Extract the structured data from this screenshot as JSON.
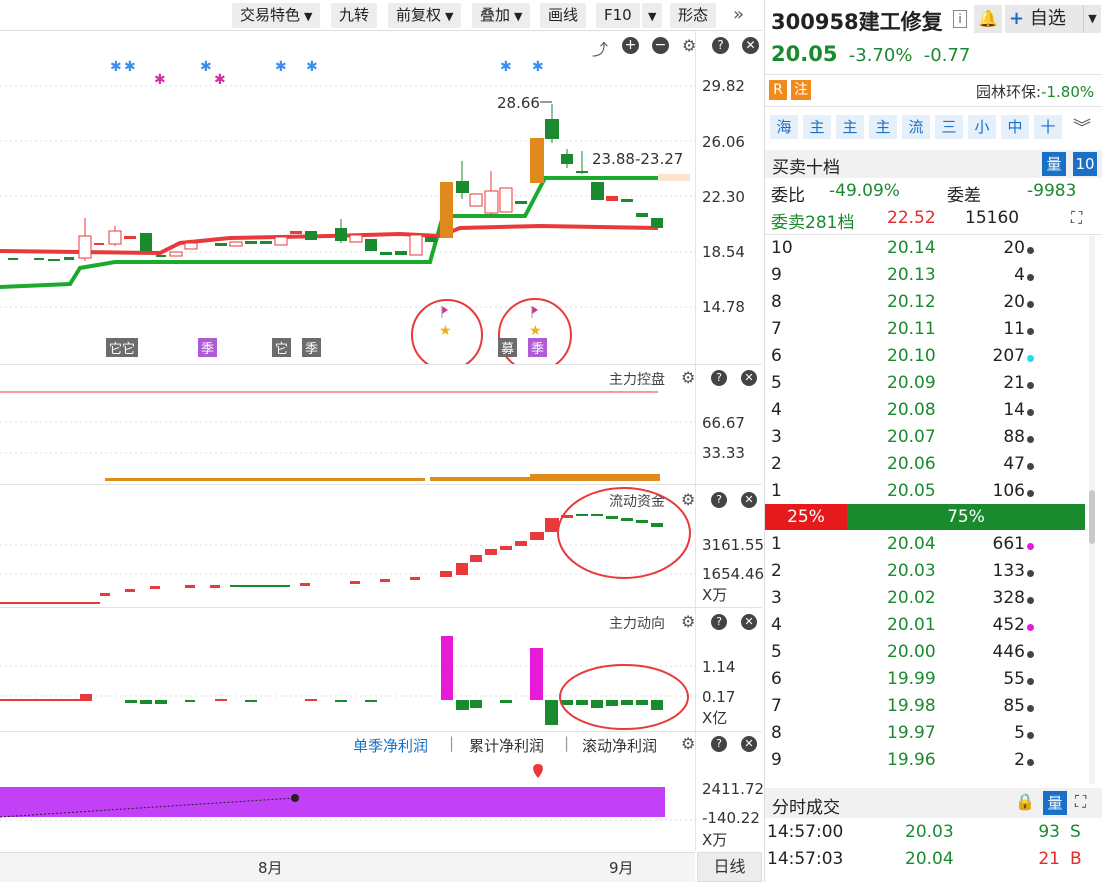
{
  "toolbar": {
    "items": [
      "交易特色",
      "九转",
      "前复权",
      "叠加",
      "画线",
      "F10",
      "形态"
    ],
    "more_icon": "double-chevron-right-icon"
  },
  "chart": {
    "y_labels": [
      "29.82",
      "26.06",
      "22.30",
      "18.54",
      "14.78"
    ],
    "annotation_high": "28.66",
    "annotation_range": "23.88-23.27",
    "bottom_tags": [
      "它它",
      "季",
      "它",
      "季",
      "募",
      "季"
    ]
  },
  "panels": {
    "control": {
      "title": "主力控盘",
      "y_labels": [
        "66.67",
        "33.33"
      ]
    },
    "flow": {
      "title": "流动资金",
      "y_labels": [
        "3161.55",
        "1654.46"
      ],
      "unit": "X万"
    },
    "direction": {
      "title": "主力动向",
      "y_labels": [
        "1.14",
        "0.17"
      ],
      "unit": "X亿"
    },
    "profit": {
      "tabs": [
        "单季净利润",
        "累计净利润",
        "滚动净利润"
      ],
      "y_labels": [
        "2411.72",
        "-140.22"
      ],
      "unit": "X万"
    }
  },
  "x_axis": {
    "labels": [
      "8月",
      "9月"
    ],
    "period_button": "日线"
  },
  "stock": {
    "code_name": "300958建工修复",
    "price": "20.05",
    "change_pct": "-3.70%",
    "change": "-0.77",
    "add_watchlist": "自选",
    "badges": [
      "R",
      "注"
    ],
    "sector": "园林环保:",
    "sector_change": "-1.80%",
    "quick_tags": [
      "海",
      "主",
      "主",
      "主",
      "流",
      "三",
      "小",
      "中",
      "十"
    ]
  },
  "orderbook": {
    "title": "买卖十档",
    "qty_button": "量",
    "depth_button": "10",
    "ratio_label": "委比",
    "ratio_value": "-49.09%",
    "diff_label": "委差",
    "diff_value": "-9983",
    "sell_total_label": "委卖281档",
    "sell_total_price": "22.52",
    "sell_total_vol": "15160",
    "asks": [
      {
        "level": "10",
        "price": "20.14",
        "vol": "20",
        "dot": "#444444"
      },
      {
        "level": "9",
        "price": "20.13",
        "vol": "4",
        "dot": "#444444"
      },
      {
        "level": "8",
        "price": "20.12",
        "vol": "20",
        "dot": "#444444"
      },
      {
        "level": "7",
        "price": "20.11",
        "vol": "11",
        "dot": "#444444"
      },
      {
        "level": "6",
        "price": "20.10",
        "vol": "207",
        "dot": "#2ad8e6"
      },
      {
        "level": "5",
        "price": "20.09",
        "vol": "21",
        "dot": "#444444"
      },
      {
        "level": "4",
        "price": "20.08",
        "vol": "14",
        "dot": "#444444"
      },
      {
        "level": "3",
        "price": "20.07",
        "vol": "88",
        "dot": "#444444"
      },
      {
        "level": "2",
        "price": "20.06",
        "vol": "47",
        "dot": "#444444"
      },
      {
        "level": "1",
        "price": "20.05",
        "vol": "106",
        "dot": "#444444"
      }
    ],
    "buy_pct": "25%",
    "sell_pct": "75%",
    "bids": [
      {
        "level": "1",
        "price": "20.04",
        "vol": "661",
        "dot": "#e61ad8"
      },
      {
        "level": "2",
        "price": "20.03",
        "vol": "133",
        "dot": "#444444"
      },
      {
        "level": "3",
        "price": "20.02",
        "vol": "328",
        "dot": "#444444"
      },
      {
        "level": "4",
        "price": "20.01",
        "vol": "452",
        "dot": "#e61ad8"
      },
      {
        "level": "5",
        "price": "20.00",
        "vol": "446",
        "dot": "#444444"
      },
      {
        "level": "6",
        "price": "19.99",
        "vol": "55",
        "dot": "#444444"
      },
      {
        "level": "7",
        "price": "19.98",
        "vol": "85",
        "dot": "#444444"
      },
      {
        "level": "8",
        "price": "19.97",
        "vol": "5",
        "dot": "#444444"
      },
      {
        "level": "9",
        "price": "19.96",
        "vol": "2",
        "dot": "#444444"
      }
    ]
  },
  "ticks": {
    "title": "分时成交",
    "qty_button": "量",
    "rows": [
      {
        "time": "14:57:00",
        "price": "20.03",
        "vol": "93",
        "side": "S"
      },
      {
        "time": "14:57:03",
        "price": "20.04",
        "vol": "21",
        "side": "B"
      }
    ]
  }
}
